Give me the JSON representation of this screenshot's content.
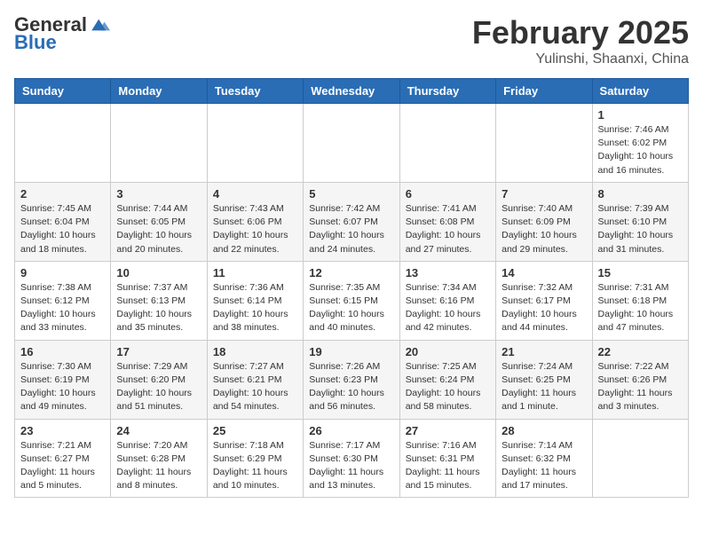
{
  "header": {
    "logo_general": "General",
    "logo_blue": "Blue",
    "month_title": "February 2025",
    "location": "Yulinshi, Shaanxi, China"
  },
  "weekdays": [
    "Sunday",
    "Monday",
    "Tuesday",
    "Wednesday",
    "Thursday",
    "Friday",
    "Saturday"
  ],
  "weeks": [
    [
      {
        "day": "",
        "info": ""
      },
      {
        "day": "",
        "info": ""
      },
      {
        "day": "",
        "info": ""
      },
      {
        "day": "",
        "info": ""
      },
      {
        "day": "",
        "info": ""
      },
      {
        "day": "",
        "info": ""
      },
      {
        "day": "1",
        "info": "Sunrise: 7:46 AM\nSunset: 6:02 PM\nDaylight: 10 hours\nand 16 minutes."
      }
    ],
    [
      {
        "day": "2",
        "info": "Sunrise: 7:45 AM\nSunset: 6:04 PM\nDaylight: 10 hours\nand 18 minutes."
      },
      {
        "day": "3",
        "info": "Sunrise: 7:44 AM\nSunset: 6:05 PM\nDaylight: 10 hours\nand 20 minutes."
      },
      {
        "day": "4",
        "info": "Sunrise: 7:43 AM\nSunset: 6:06 PM\nDaylight: 10 hours\nand 22 minutes."
      },
      {
        "day": "5",
        "info": "Sunrise: 7:42 AM\nSunset: 6:07 PM\nDaylight: 10 hours\nand 24 minutes."
      },
      {
        "day": "6",
        "info": "Sunrise: 7:41 AM\nSunset: 6:08 PM\nDaylight: 10 hours\nand 27 minutes."
      },
      {
        "day": "7",
        "info": "Sunrise: 7:40 AM\nSunset: 6:09 PM\nDaylight: 10 hours\nand 29 minutes."
      },
      {
        "day": "8",
        "info": "Sunrise: 7:39 AM\nSunset: 6:10 PM\nDaylight: 10 hours\nand 31 minutes."
      }
    ],
    [
      {
        "day": "9",
        "info": "Sunrise: 7:38 AM\nSunset: 6:12 PM\nDaylight: 10 hours\nand 33 minutes."
      },
      {
        "day": "10",
        "info": "Sunrise: 7:37 AM\nSunset: 6:13 PM\nDaylight: 10 hours\nand 35 minutes."
      },
      {
        "day": "11",
        "info": "Sunrise: 7:36 AM\nSunset: 6:14 PM\nDaylight: 10 hours\nand 38 minutes."
      },
      {
        "day": "12",
        "info": "Sunrise: 7:35 AM\nSunset: 6:15 PM\nDaylight: 10 hours\nand 40 minutes."
      },
      {
        "day": "13",
        "info": "Sunrise: 7:34 AM\nSunset: 6:16 PM\nDaylight: 10 hours\nand 42 minutes."
      },
      {
        "day": "14",
        "info": "Sunrise: 7:32 AM\nSunset: 6:17 PM\nDaylight: 10 hours\nand 44 minutes."
      },
      {
        "day": "15",
        "info": "Sunrise: 7:31 AM\nSunset: 6:18 PM\nDaylight: 10 hours\nand 47 minutes."
      }
    ],
    [
      {
        "day": "16",
        "info": "Sunrise: 7:30 AM\nSunset: 6:19 PM\nDaylight: 10 hours\nand 49 minutes."
      },
      {
        "day": "17",
        "info": "Sunrise: 7:29 AM\nSunset: 6:20 PM\nDaylight: 10 hours\nand 51 minutes."
      },
      {
        "day": "18",
        "info": "Sunrise: 7:27 AM\nSunset: 6:21 PM\nDaylight: 10 hours\nand 54 minutes."
      },
      {
        "day": "19",
        "info": "Sunrise: 7:26 AM\nSunset: 6:23 PM\nDaylight: 10 hours\nand 56 minutes."
      },
      {
        "day": "20",
        "info": "Sunrise: 7:25 AM\nSunset: 6:24 PM\nDaylight: 10 hours\nand 58 minutes."
      },
      {
        "day": "21",
        "info": "Sunrise: 7:24 AM\nSunset: 6:25 PM\nDaylight: 11 hours\nand 1 minute."
      },
      {
        "day": "22",
        "info": "Sunrise: 7:22 AM\nSunset: 6:26 PM\nDaylight: 11 hours\nand 3 minutes."
      }
    ],
    [
      {
        "day": "23",
        "info": "Sunrise: 7:21 AM\nSunset: 6:27 PM\nDaylight: 11 hours\nand 5 minutes."
      },
      {
        "day": "24",
        "info": "Sunrise: 7:20 AM\nSunset: 6:28 PM\nDaylight: 11 hours\nand 8 minutes."
      },
      {
        "day": "25",
        "info": "Sunrise: 7:18 AM\nSunset: 6:29 PM\nDaylight: 11 hours\nand 10 minutes."
      },
      {
        "day": "26",
        "info": "Sunrise: 7:17 AM\nSunset: 6:30 PM\nDaylight: 11 hours\nand 13 minutes."
      },
      {
        "day": "27",
        "info": "Sunrise: 7:16 AM\nSunset: 6:31 PM\nDaylight: 11 hours\nand 15 minutes."
      },
      {
        "day": "28",
        "info": "Sunrise: 7:14 AM\nSunset: 6:32 PM\nDaylight: 11 hours\nand 17 minutes."
      },
      {
        "day": "",
        "info": ""
      }
    ]
  ]
}
